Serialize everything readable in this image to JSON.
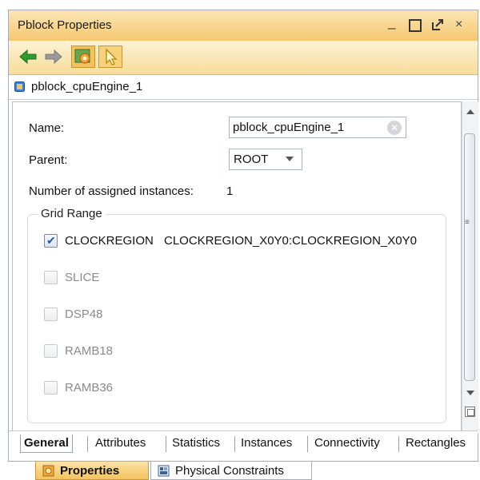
{
  "window": {
    "title": "Pblock Properties",
    "controls": {
      "minimize": "_",
      "close": "×"
    }
  },
  "toolbar": {
    "icons": [
      "back-arrow-icon",
      "forward-arrow-icon",
      "options-gear-icon",
      "select-cursor-icon"
    ]
  },
  "object": {
    "name": "pblock_cpuEngine_1"
  },
  "general": {
    "name_label": "Name:",
    "name_value": "pblock_cpuEngine_1",
    "parent_label": "Parent:",
    "parent_value": "ROOT",
    "instances_label": "Number of assigned instances:",
    "instances_value": "1"
  },
  "grid_range": {
    "title": "Grid Range",
    "items": [
      {
        "label": "CLOCKREGION",
        "checked": true,
        "enabled": true,
        "range": "CLOCKREGION_X0Y0:CLOCKREGION_X0Y0"
      },
      {
        "label": "SLICE",
        "checked": false,
        "enabled": false,
        "range": ""
      },
      {
        "label": "DSP48",
        "checked": false,
        "enabled": false,
        "range": ""
      },
      {
        "label": "RAMB18",
        "checked": false,
        "enabled": false,
        "range": ""
      },
      {
        "label": "RAMB36",
        "checked": false,
        "enabled": false,
        "range": ""
      }
    ]
  },
  "tabs": [
    "General",
    "Attributes",
    "Statistics",
    "Instances",
    "Connectivity",
    "Rectangles"
  ],
  "active_tab": "General",
  "bottom_tabs": [
    {
      "label": "Properties",
      "active": true
    },
    {
      "label": "Physical Constraints",
      "active": false
    }
  ],
  "colors": {
    "titlebar": "#f5c770",
    "accent_blue": "#2a55a5",
    "disabled_text": "#8a8a8a"
  }
}
